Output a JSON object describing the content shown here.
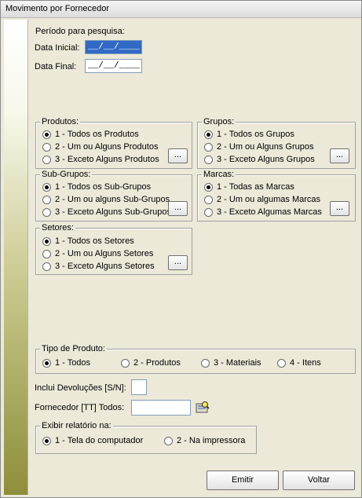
{
  "window": {
    "title": "Movimento por Fornecedor"
  },
  "period": {
    "label": "Período para pesquisa:",
    "start_label": "Data Inicial:",
    "start_value": "__/__/____",
    "end_label": "Data Final:",
    "end_value": "__/__/____"
  },
  "produtos": {
    "legend": "Produtos:",
    "options": [
      "1 - Todos os Produtos",
      "2 - Um ou Alguns Produtos",
      "3 - Exceto Alguns Produtos"
    ],
    "selected": 0,
    "button": "..."
  },
  "grupos": {
    "legend": "Grupos:",
    "options": [
      "1 - Todos os Grupos",
      "2 - Um ou Alguns Grupos",
      "3 - Exceto Alguns Grupos"
    ],
    "selected": 0,
    "button": "..."
  },
  "subgrupos": {
    "legend": "Sub-Grupos:",
    "options": [
      "1 - Todos os Sub-Grupos",
      "2 - Um ou alguns Sub-Grupos",
      "3 - Exceto Alguns Sub-Grupos"
    ],
    "selected": 0,
    "button": "..."
  },
  "marcas": {
    "legend": "Marcas:",
    "options": [
      "1 - Todas as Marcas",
      "2 - Um ou algumas Marcas",
      "3 - Exceto Algumas Marcas"
    ],
    "selected": 0,
    "button": "..."
  },
  "setores": {
    "legend": "Setores:",
    "options": [
      "1 - Todos os Setores",
      "2 - Um ou Alguns Setores",
      "3 - Exceto Alguns Setores"
    ],
    "selected": 0,
    "button": "..."
  },
  "tipo": {
    "legend": "Tipo de Produto:",
    "options": [
      "1 - Todos",
      "2 - Produtos",
      "3 - Materiais",
      "4 - Itens"
    ],
    "selected": 0
  },
  "devolucoes": {
    "label": "Inclui Devoluções [S/N]:",
    "value": ""
  },
  "fornecedor": {
    "label": "Fornecedor [TT] Todos:",
    "value": "",
    "icon": "search-lookup-icon"
  },
  "exibir": {
    "legend": "Exibir relatório na:",
    "options": [
      "1 - Tela do computador",
      "2 - Na impressora"
    ],
    "selected": 0
  },
  "buttons": {
    "emitir": "Emitir",
    "voltar": "Voltar"
  }
}
